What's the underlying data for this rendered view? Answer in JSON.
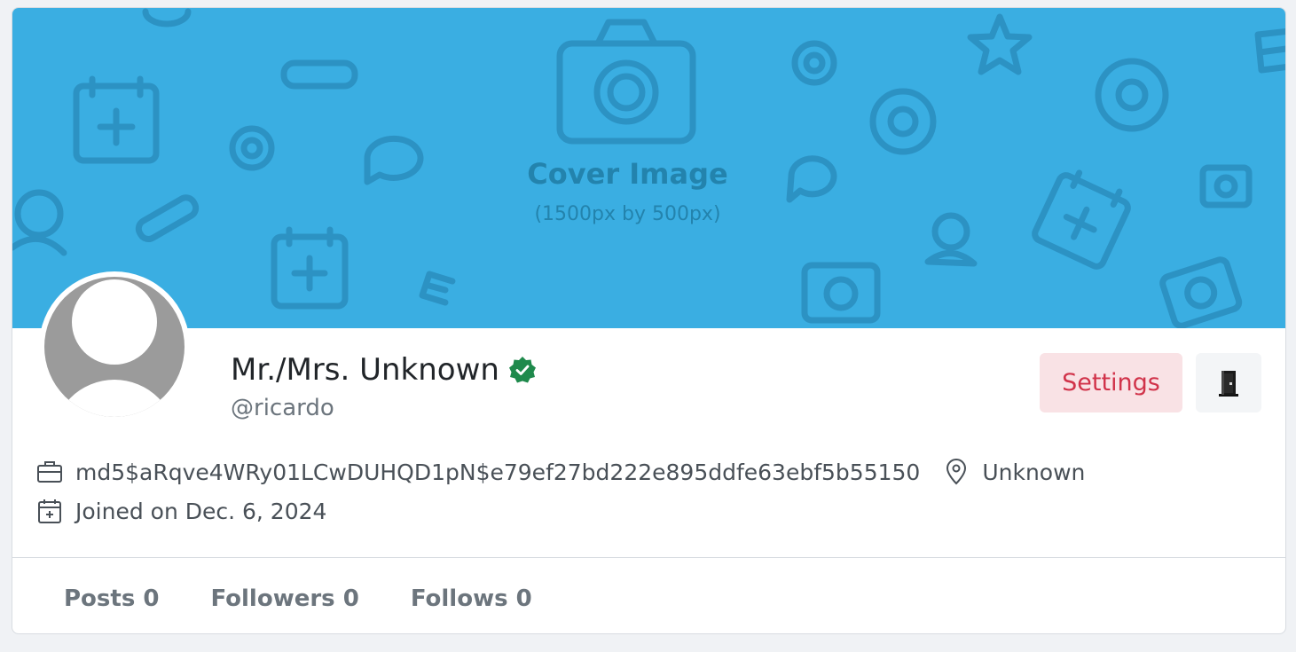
{
  "cover": {
    "title": "Cover Image",
    "subtitle": "(1500px by 500px)",
    "background_color": "#3aaee2"
  },
  "profile": {
    "display_name": "Mr./Mrs. Unknown",
    "handle": "@ricardo",
    "verified_icon": "verified-badge-icon",
    "verified_color": "#1f8a4c"
  },
  "actions": {
    "settings_label": "Settings",
    "logout_icon": "door-icon"
  },
  "meta": {
    "work_icon": "briefcase-icon",
    "work": "md5$aRqve4WRy01LCwDUHQD1pN$e79ef27bd222e895ddfe63ebf5b55150",
    "location_icon": "location-pin-icon",
    "location": "Unknown",
    "joined_icon": "calendar-plus-icon",
    "joined": "Joined on Dec. 6, 2024"
  },
  "stats": {
    "posts": "Posts 0",
    "followers": "Followers 0",
    "follows": "Follows 0"
  }
}
